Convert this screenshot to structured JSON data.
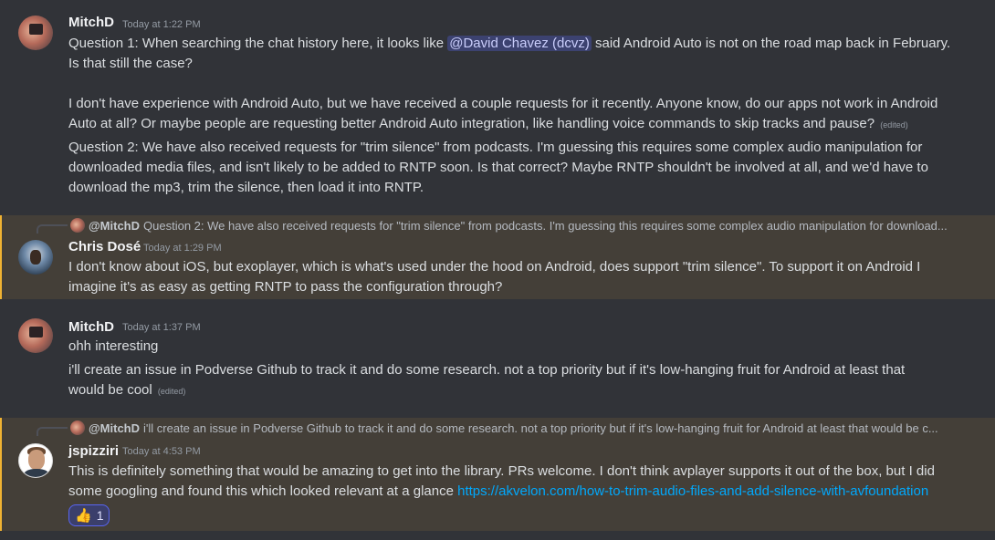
{
  "messages": [
    {
      "author": "MitchD",
      "timestamp": "Today at 1:22 PM",
      "lines": {
        "l1a": "Question 1: When searching the chat history here, it looks like",
        "l1_mention": "@David Chavez (dcvz)",
        "l1b": "said Android Auto is not on the road map back in February.",
        "l2": "Is that still the case?",
        "l3": "I don't have experience with Android Auto, but we have received a couple requests for it recently. Anyone know, do our apps not work in Android",
        "l4": "Auto at all? Or maybe people are requesting better Android Auto integration, like handling voice commands to skip tracks and pause?",
        "l4_edited": "(edited)",
        "l5": "Question 2: We have also received requests for \"trim silence\" from podcasts. I'm guessing this requires some complex audio manipulation for",
        "l6": "downloaded media files, and isn't likely to be added to RNTP soon. Is that correct? Maybe RNTP shouldn't be involved at all, and we'd have to",
        "l7": "download the mp3, trim the silence, then load it into RNTP."
      }
    },
    {
      "reply_to": "@MitchD",
      "reply_preview": "Question 2: We have also received requests for \"trim silence\" from podcasts. I'm guessing this requires some complex audio manipulation for download...",
      "author": "Chris Dosé",
      "timestamp": "Today at 1:29 PM",
      "lines": {
        "l1": "I don't know about iOS, but exoplayer, which is what's used under the hood on Android, does support \"trim silence\". To support it on Android I",
        "l2": "imagine it's as easy as getting RNTP to pass the configuration through?"
      }
    },
    {
      "author": "MitchD",
      "timestamp": "Today at 1:37 PM",
      "lines": {
        "l1": "ohh interesting",
        "l2": "i'll create an issue in Podverse Github to track it and do some research. not a top priority but if it's low-hanging fruit for Android at least that",
        "l3": "would be cool",
        "l3_edited": "(edited)"
      }
    },
    {
      "reply_to": "@MitchD",
      "reply_preview": "i'll create an issue in Podverse Github to track it and do some research. not a top priority but if it's low-hanging fruit for Android at least that would be c...",
      "author": "jspizziri",
      "timestamp": "Today at 4:53 PM",
      "lines": {
        "l1": "This is definitely something that would be amazing to get into the library. PRs welcome. I don't think avplayer supports it out of the box, but I did",
        "l2a": "some googling and found this which looked relevant at a glance",
        "l2_link": "https://akvelon.com/how-to-trim-audio-files-and-add-silence-with-avfoundation"
      },
      "reaction": {
        "emoji": "👍",
        "count": "1"
      }
    }
  ],
  "colors": {
    "background": "#313338",
    "highlight_bg": "#443f38",
    "highlight_border": "#f0b232",
    "mention_bg": "#3c4270",
    "link": "#00a8fc"
  },
  "icons": [
    "user-avatar",
    "reply-avatar",
    "thumbs-up-emoji"
  ]
}
